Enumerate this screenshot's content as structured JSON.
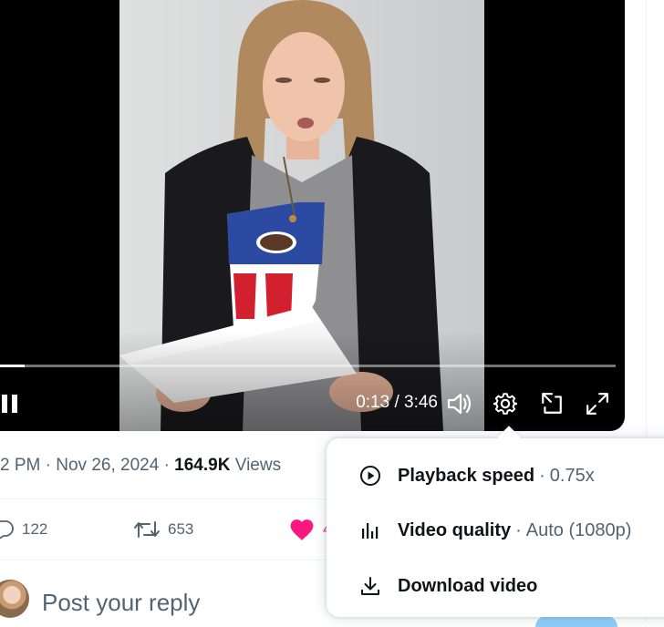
{
  "player": {
    "current_time": "0:13",
    "duration": "3:46",
    "progress_fraction": 0.04
  },
  "tweet": {
    "time": "2 PM",
    "date": "Nov 26, 2024",
    "views_count": "164.9K",
    "views_label": "Views",
    "replies": "122",
    "reposts": "653",
    "likes": "4"
  },
  "composer": {
    "placeholder": "Post your reply"
  },
  "settings_menu": {
    "playback_speed_label": "Playback speed",
    "playback_speed_value": "0.75x",
    "video_quality_label": "Video quality",
    "video_quality_value": "Auto (1080p)",
    "download_label": "Download video",
    "separator": "·"
  },
  "colors": {
    "accent_like": "#f91880",
    "text_secondary": "#536471",
    "text_primary": "#0f1419"
  },
  "icons": [
    "pause-icon",
    "volume-icon",
    "settings-gear-icon",
    "picture-in-picture-icon",
    "fullscreen-icon",
    "reply-icon",
    "repost-icon",
    "heart-icon",
    "play-circle-icon",
    "quality-bars-icon",
    "download-icon"
  ]
}
